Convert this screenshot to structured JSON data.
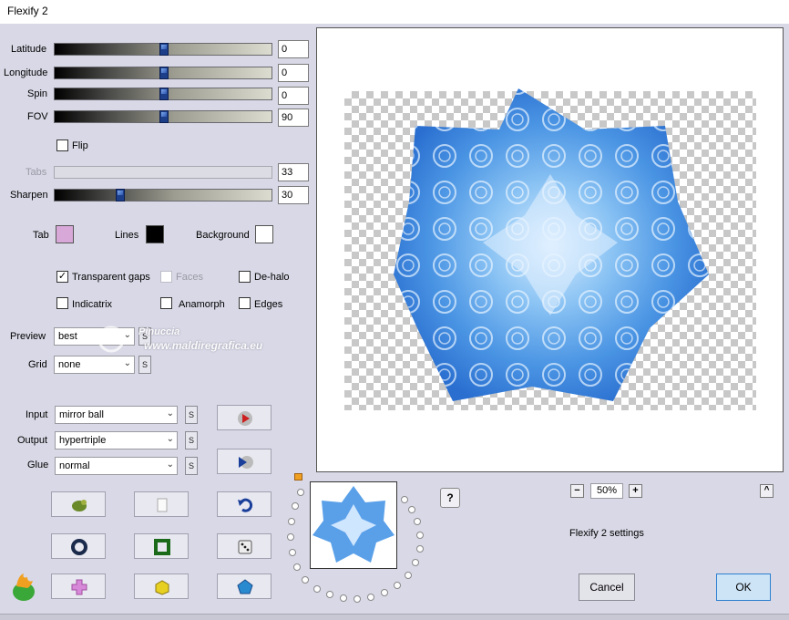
{
  "window": {
    "title": "Flexify 2"
  },
  "sliders": [
    {
      "label": "Latitude",
      "value": "0",
      "position": 0.5,
      "disabled": false
    },
    {
      "label": "Longitude",
      "value": "0",
      "position": 0.5,
      "disabled": false
    },
    {
      "label": "Spin",
      "value": "0",
      "position": 0.5,
      "disabled": false
    },
    {
      "label": "FOV",
      "value": "90",
      "position": 0.5,
      "disabled": false
    },
    {
      "label": "Tabs",
      "value": "33",
      "position": null,
      "disabled": true
    },
    {
      "label": "Sharpen",
      "value": "30",
      "position": 0.3,
      "disabled": false
    }
  ],
  "flip": {
    "label": "Flip",
    "checked": false
  },
  "colors": {
    "tab": {
      "label": "Tab",
      "value": "#d7a8d8"
    },
    "lines": {
      "label": "Lines",
      "value": "#000000"
    },
    "background": {
      "label": "Background",
      "value": "#ffffff"
    }
  },
  "checkboxes": {
    "transparent_gaps": {
      "label": "Transparent gaps",
      "checked": true
    },
    "faces": {
      "label": "Faces",
      "checked": false,
      "disabled": true
    },
    "de_halo": {
      "label": "De-halo",
      "checked": false
    },
    "indicatrix": {
      "label": "Indicatrix",
      "checked": false
    },
    "anamorph": {
      "label": "Anamorph",
      "checked": false
    },
    "edges": {
      "label": "Edges",
      "checked": false
    }
  },
  "preview_select": {
    "label": "Preview",
    "value": "best",
    "s": "S"
  },
  "grid_select": {
    "label": "Grid",
    "value": "none",
    "s": "S"
  },
  "input_select": {
    "label": "Input",
    "value": "mirror ball",
    "s": "S"
  },
  "output_select": {
    "label": "Output",
    "value": "hypertriple",
    "s": "S"
  },
  "glue_select": {
    "label": "Glue",
    "value": "normal",
    "s": "S"
  },
  "watermark": {
    "line1": "Pinuccia",
    "line2": "www.maldiregrafica.eu"
  },
  "zoom": {
    "minus": "−",
    "value": "50%",
    "plus": "+"
  },
  "settings_label": "Flexify 2 settings",
  "help": "?",
  "collapse": "^",
  "buttons": {
    "cancel": "Cancel",
    "ok": "OK"
  },
  "accent": {
    "preview_blue": "#5aa0e8",
    "ok_border": "#2d7fd0"
  }
}
